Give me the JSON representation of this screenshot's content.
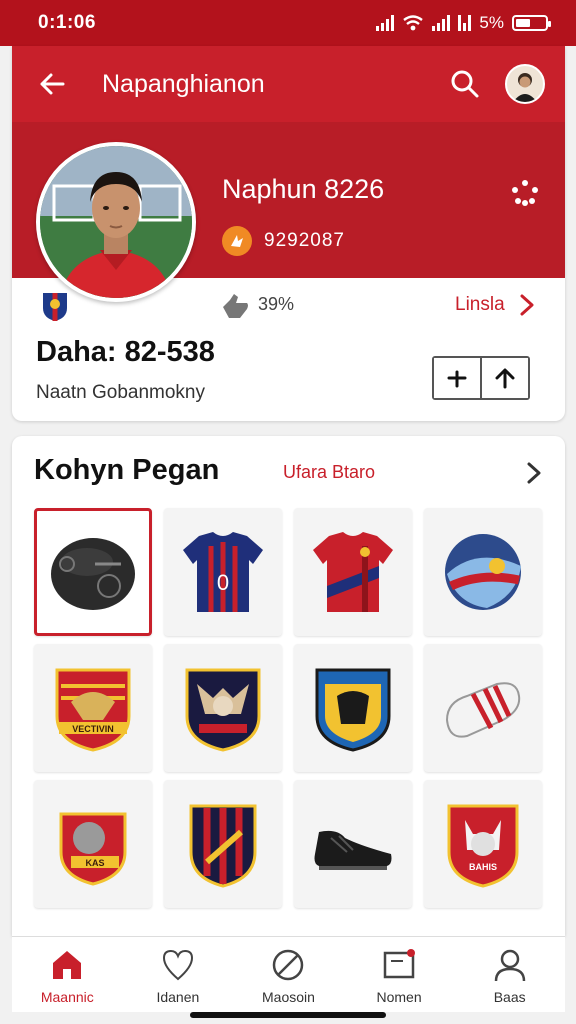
{
  "status": {
    "time": "0:1:06",
    "battery": "5%",
    "battery_level": 0.5
  },
  "appbar": {
    "title": "Napanghianon"
  },
  "profile": {
    "name": "Naphun 8226",
    "coins": "9292087",
    "like_percent": "39%",
    "info_link": "Linsla",
    "data_line": "Daha: 82-538",
    "subline": "Naatn Gobanmokny"
  },
  "collection": {
    "title": "Kohyn Pegan",
    "link": "Ufara Btaro",
    "items": [
      {
        "name": "black-ball-item",
        "selected": true
      },
      {
        "name": "blue-jersey-item",
        "number": "0"
      },
      {
        "name": "red-jersey-item"
      },
      {
        "name": "football-item"
      },
      {
        "name": "eagle-badge-item",
        "text": "VECTIVIN"
      },
      {
        "name": "fox-badge-item"
      },
      {
        "name": "blue-crest-item"
      },
      {
        "name": "boot-accessory-item"
      },
      {
        "name": "fist-crest-item",
        "text": "KAS"
      },
      {
        "name": "striped-crest-item"
      },
      {
        "name": "cleat-item"
      },
      {
        "name": "wolf-crest-item",
        "text": "BAHIS"
      }
    ]
  },
  "nav": {
    "items": [
      {
        "label": "Maannic",
        "icon": "home-icon",
        "active": true
      },
      {
        "label": "Idanen",
        "icon": "heart-icon"
      },
      {
        "label": "Maosoin",
        "icon": "no-entry-icon"
      },
      {
        "label": "Nomen",
        "icon": "notification-icon"
      },
      {
        "label": "Baas",
        "icon": "profile-icon"
      }
    ]
  },
  "colors": {
    "brand_red": "#c8202b",
    "dark_red": "#b81d27",
    "coin_orange": "#f08a24"
  }
}
